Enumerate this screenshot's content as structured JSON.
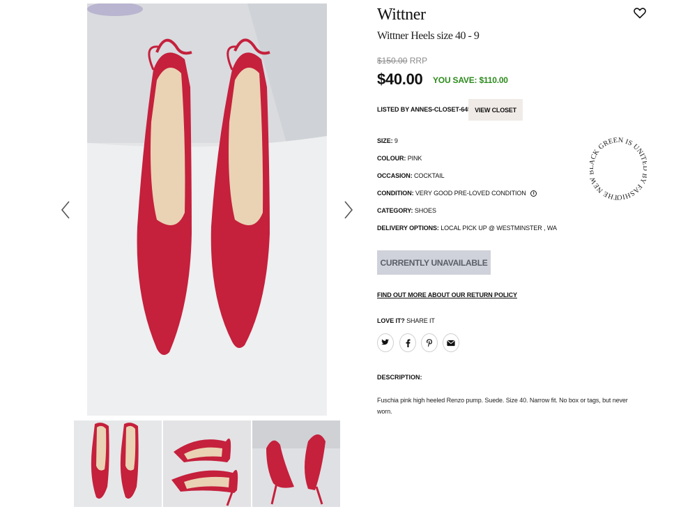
{
  "product": {
    "brand": "Wittner",
    "title": "Wittner Heels size 40 - 9",
    "rrp_price": "$150.00",
    "rrp_label": "RRP",
    "price": "$40.00",
    "you_save": "YOU SAVE: $110.00"
  },
  "seller": {
    "listed_by": "LISTED BY ANNES-CLOSET-64561",
    "view_closet_label": "VIEW CLOSET"
  },
  "attributes": [
    {
      "key": "SIZE:",
      "value": "9"
    },
    {
      "key": "COLOUR:",
      "value": "PINK"
    },
    {
      "key": "OCCASION:",
      "value": "COCKTAIL"
    },
    {
      "key": "CONDITION:",
      "value": "VERY GOOD PRE-LOVED CONDITION"
    },
    {
      "key": "CATEGORY:",
      "value": "SHOES"
    },
    {
      "key": "DELIVERY OPTIONS:",
      "value": "LOCAL PICK UP @ WESTMINSTER , WA"
    }
  ],
  "condition_info_glyph": "i",
  "actions": {
    "unavailable_label": "CURRENTLY UNAVAILABLE",
    "returns_link": "FIND OUT MORE ABOUT OUR RETURN POLICY"
  },
  "share": {
    "label_bold": "LOVE IT?",
    "label_rest": "SHARE IT",
    "icons": [
      "twitter-icon",
      "facebook-icon",
      "pinterest-icon",
      "email-icon"
    ]
  },
  "description": {
    "heading": "DESCRIPTION:",
    "text": "Fuschia pink high heeled Renzo pump. Suede. Size 40. Narrow fit. No box or tags, but never worn."
  },
  "badge_text": "THE NEW BLACK GREEN IS UNITED BY FASHION",
  "colors": {
    "shoe": "#c5203c",
    "save_green": "#2d8a1d",
    "closet_button_bg": "#f1ebe8",
    "unavailable_bg": "#cfd2da"
  }
}
